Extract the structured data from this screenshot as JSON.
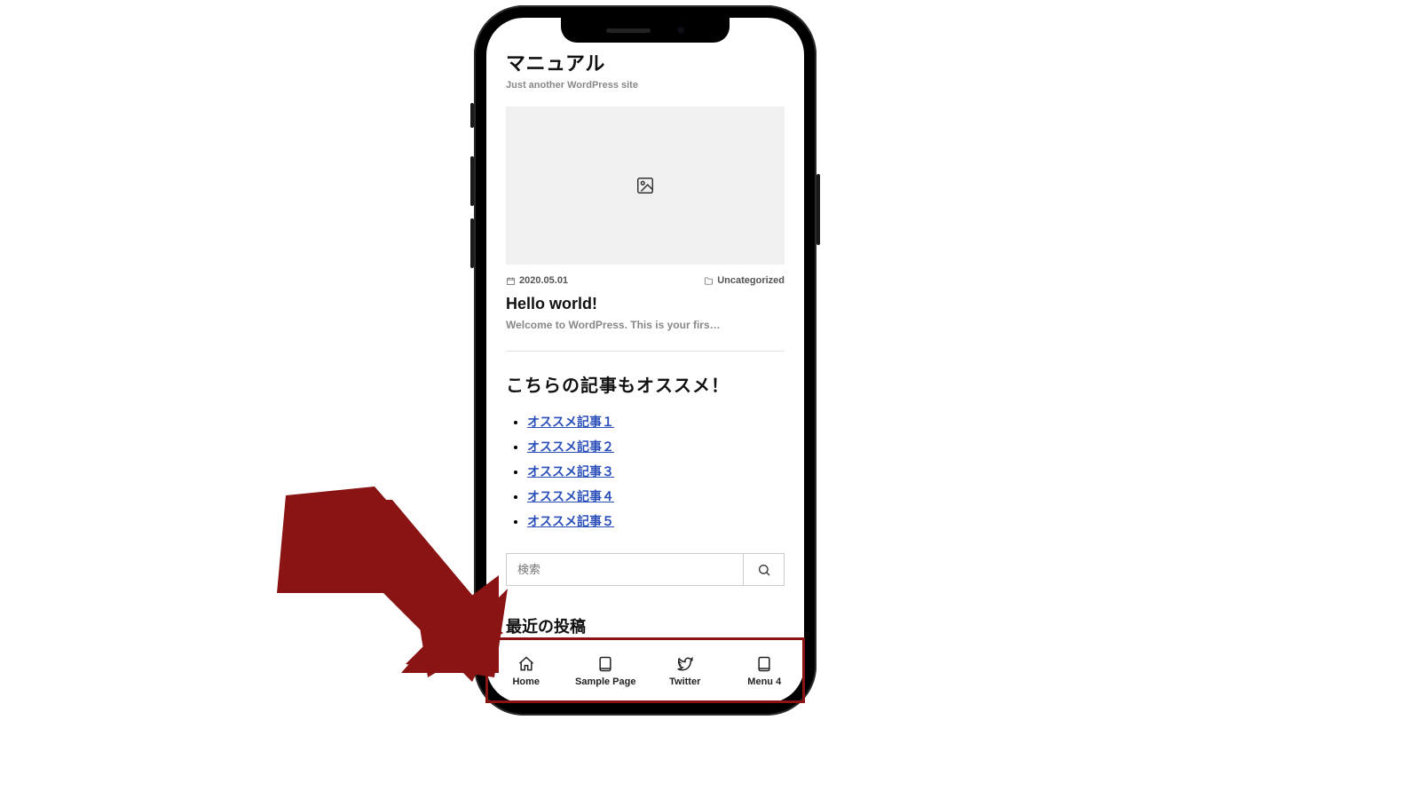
{
  "site": {
    "title": "マニュアル",
    "tagline": "Just another WordPress site"
  },
  "post": {
    "date": "2020.05.01",
    "category": "Uncategorized",
    "title": "Hello world!",
    "excerpt": "Welcome to WordPress. This is your firs…"
  },
  "recommend": {
    "heading": "こちらの記事もオススメ！",
    "items": [
      "オススメ記事１",
      "オススメ記事２",
      "オススメ記事３",
      "オススメ記事４",
      "オススメ記事５"
    ]
  },
  "search": {
    "placeholder": "検索"
  },
  "recent": {
    "heading": "最近の投稿"
  },
  "nav": {
    "items": [
      {
        "label": "Home",
        "icon": "home"
      },
      {
        "label": "Sample Page",
        "icon": "page"
      },
      {
        "label": "Twitter",
        "icon": "twitter"
      },
      {
        "label": "Menu 4",
        "icon": "page"
      }
    ]
  }
}
